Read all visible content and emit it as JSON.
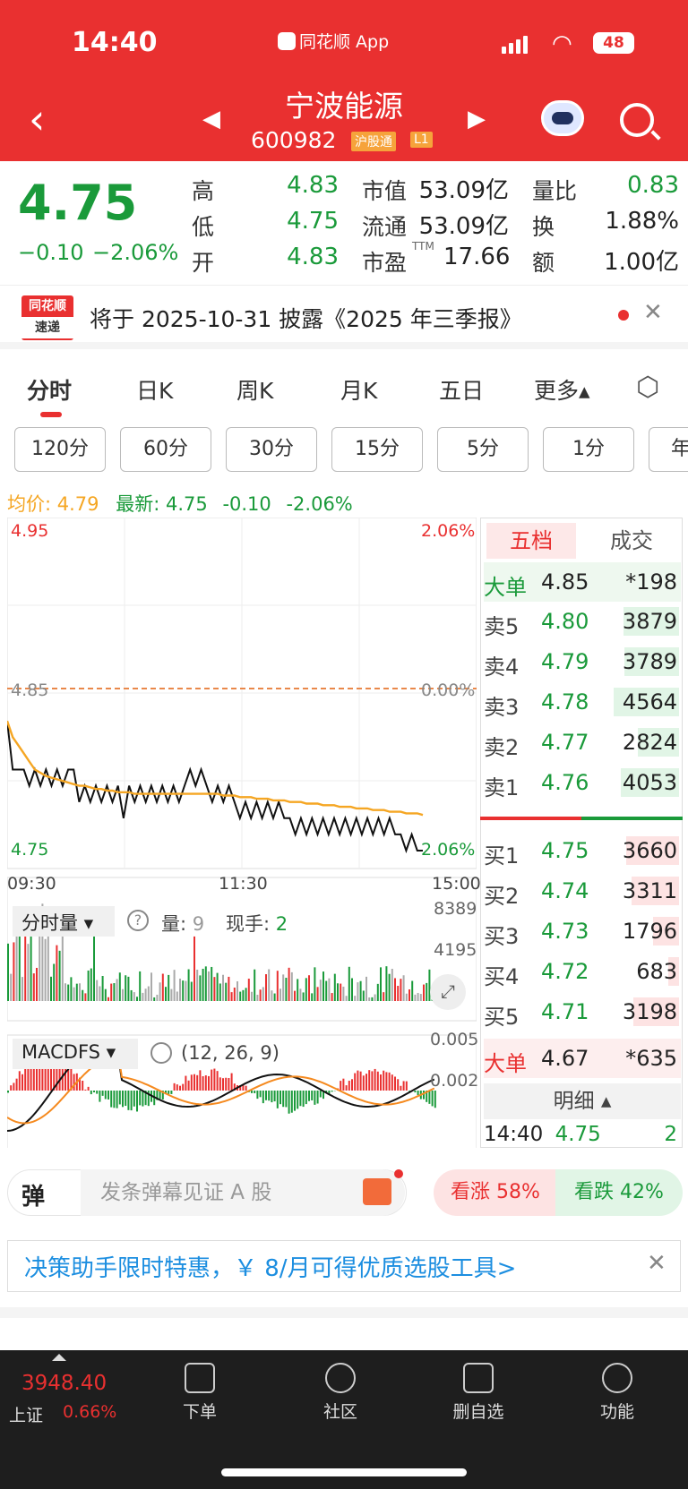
{
  "status": {
    "time": "14:40",
    "app": "同花顺 App",
    "battery": "48"
  },
  "stock": {
    "name": "宁波能源",
    "code": "600982",
    "tag1": "沪股通",
    "tag2": "L1"
  },
  "quote": {
    "price": "4.75",
    "change": "−0.10",
    "change_pct": "−2.06%",
    "high_label": "高",
    "high": "4.83",
    "low_label": "低",
    "low": "4.75",
    "open_label": "开",
    "open": "4.83",
    "mcap_label": "市值",
    "mcap": "53.09亿",
    "float_label": "流通",
    "float": "53.09亿",
    "pe_label": "市盈",
    "pe_sup": "TTM",
    "pe": "17.66",
    "vr_label": "量比",
    "vr": "0.83",
    "turn_label": "换",
    "turn": "1.88%",
    "amt_label": "额",
    "amt": "1.00亿"
  },
  "notice": {
    "logo_line1": "同花顺",
    "logo_line2": "速递",
    "text": "将于 2025-10-31 披露《2025 年三季报》"
  },
  "tabs": [
    {
      "label": "分时",
      "active": true
    },
    {
      "label": "日K"
    },
    {
      "label": "周K"
    },
    {
      "label": "月K"
    },
    {
      "label": "五日"
    },
    {
      "label": "更多▴"
    }
  ],
  "periods": [
    "120分",
    "60分",
    "30分",
    "15分",
    "5分",
    "1分",
    "年"
  ],
  "legend": {
    "avg_label": "均价: ",
    "avg": "4.79",
    "last_label": "最新: ",
    "last": "4.75",
    "chg": "-0.10",
    "chg_pct": "-2.06%"
  },
  "chart_data": {
    "type": "line",
    "title": "",
    "y_labels": {
      "top": "4.95",
      "mid": "4.85",
      "bottom": "4.75"
    },
    "pct_labels": {
      "top": "2.06%",
      "mid": "0.00%",
      "bottom": "2.06%"
    },
    "ylim": [
      4.75,
      4.95
    ],
    "prev_close": 4.85,
    "x_ticks": [
      "09:30",
      "11:30",
      "15:00"
    ],
    "series": [
      {
        "color": "#111111",
        "values": [
          4.83,
          4.8,
          4.8,
          4.8,
          4.79,
          4.8,
          4.79,
          4.8,
          4.79,
          4.8,
          4.79,
          4.8,
          4.8,
          4.78,
          4.79,
          4.78,
          4.79,
          4.78,
          4.79,
          4.78,
          4.79,
          4.77,
          4.79,
          4.78,
          4.79,
          4.78,
          4.79,
          4.78,
          4.79,
          4.78,
          4.79,
          4.78,
          4.79,
          4.8,
          4.79,
          4.8,
          4.79,
          4.78,
          4.79,
          4.78,
          4.79,
          4.78,
          4.77,
          4.78,
          4.77,
          4.78,
          4.77,
          4.78,
          4.77,
          4.78,
          4.77,
          4.77,
          4.76,
          4.77,
          4.76,
          4.77,
          4.76,
          4.77,
          4.76,
          4.77,
          4.76,
          4.77,
          4.76,
          4.77,
          4.76,
          4.77,
          4.76,
          4.77,
          4.76,
          4.77,
          4.76,
          4.76,
          4.75,
          4.76,
          4.75,
          4.75
        ]
      },
      {
        "color": "#f5a623",
        "values": [
          4.83,
          4.82,
          4.815,
          4.81,
          4.805,
          4.8,
          4.798,
          4.796,
          4.795,
          4.794,
          4.793,
          4.792,
          4.791,
          4.79,
          4.79,
          4.789,
          4.788,
          4.788,
          4.787,
          4.787,
          4.786,
          4.786,
          4.786,
          4.785,
          4.785,
          4.785,
          4.785,
          4.785,
          4.785,
          4.785,
          4.785,
          4.785,
          4.785,
          4.785,
          4.785,
          4.785,
          4.785,
          4.785,
          4.785,
          4.784,
          4.784,
          4.784,
          4.783,
          4.783,
          4.783,
          4.782,
          4.782,
          4.782,
          4.781,
          4.781,
          4.781,
          4.78,
          4.78,
          4.78,
          4.779,
          4.779,
          4.779,
          4.778,
          4.778,
          4.778,
          4.777,
          4.777,
          4.777,
          4.776,
          4.776,
          4.776,
          4.775,
          4.775,
          4.775,
          4.774,
          4.774,
          4.774,
          4.773,
          4.773,
          4.773,
          4.772
        ]
      }
    ],
    "volume": {
      "label": "分时量",
      "qty_label": "量:",
      "qty": "9",
      "now_label": "现手:",
      "now": "2",
      "max": "8389",
      "mid": "4195"
    },
    "macd": {
      "label": "MACDFS",
      "params": "(12, 26, 9)",
      "top": "0.005",
      "mid": "0.002"
    }
  },
  "orderbook": {
    "tab_on": "五档",
    "tab": "成交",
    "big_top": {
      "label": "大单",
      "price": "4.85",
      "vol": "*198"
    },
    "asks": [
      {
        "label": "卖5",
        "price": "4.80",
        "vol": "3879",
        "fill": 0.48
      },
      {
        "label": "卖4",
        "price": "4.79",
        "vol": "3789",
        "fill": 0.47
      },
      {
        "label": "卖3",
        "price": "4.78",
        "vol": "4564",
        "fill": 0.56
      },
      {
        "label": "卖2",
        "price": "4.77",
        "vol": "2824",
        "fill": 0.35
      },
      {
        "label": "卖1",
        "price": "4.76",
        "vol": "4053",
        "fill": 0.5
      }
    ],
    "bids": [
      {
        "label": "买1",
        "price": "4.75",
        "vol": "3660",
        "fill": 0.45
      },
      {
        "label": "买2",
        "price": "4.74",
        "vol": "3311",
        "fill": 0.41
      },
      {
        "label": "买3",
        "price": "4.73",
        "vol": "1796",
        "fill": 0.22
      },
      {
        "label": "买4",
        "price": "4.72",
        "vol": "683",
        "fill": 0.09
      },
      {
        "label": "买5",
        "price": "4.71",
        "vol": "3198",
        "fill": 0.39
      }
    ],
    "big_bottom": {
      "label": "大单",
      "price": "4.67",
      "vol": "*635"
    },
    "detail_label": "明细",
    "tick": {
      "time": "14:40",
      "price": "4.75",
      "vol": "2"
    }
  },
  "danmu": {
    "icon": "弹",
    "placeholder": "发条弹幕见证 A 股",
    "up": "看涨 58%",
    "down": "看跌 42%"
  },
  "ad": {
    "text": "决策助手限时特惠，￥ 8/月可得优质选股工具>"
  },
  "bottom_nav": {
    "index_value": "3948.40",
    "index_name": "上证",
    "index_pct": "0.66%",
    "items": [
      {
        "label": "下单",
        "icon": "order-icon"
      },
      {
        "label": "社区",
        "icon": "community-icon"
      },
      {
        "label": "删自选",
        "icon": "remove-watch-icon"
      },
      {
        "label": "功能",
        "icon": "menu-icon"
      }
    ]
  }
}
